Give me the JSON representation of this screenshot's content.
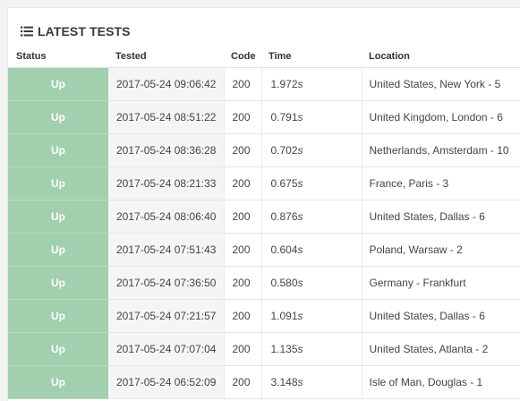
{
  "panel": {
    "title": "LATEST TESTS",
    "title_icon": "list-icon"
  },
  "table": {
    "headers": [
      "Status",
      "Tested",
      "Code",
      "Time",
      "Location"
    ],
    "rows": [
      {
        "status": "Up",
        "tested": "2017-05-24 09:06:42",
        "code": "200",
        "time": "1.972",
        "unit": "s",
        "location": "United States, New York - 5"
      },
      {
        "status": "Up",
        "tested": "2017-05-24 08:51:22",
        "code": "200",
        "time": "0.791",
        "unit": "s",
        "location": "United Kingdom, London - 6"
      },
      {
        "status": "Up",
        "tested": "2017-05-24 08:36:28",
        "code": "200",
        "time": "0.702",
        "unit": "s",
        "location": "Netherlands, Amsterdam - 10"
      },
      {
        "status": "Up",
        "tested": "2017-05-24 08:21:33",
        "code": "200",
        "time": "0.675",
        "unit": "s",
        "location": "France, Paris - 3"
      },
      {
        "status": "Up",
        "tested": "2017-05-24 08:06:40",
        "code": "200",
        "time": "0.876",
        "unit": "s",
        "location": "United States, Dallas - 6"
      },
      {
        "status": "Up",
        "tested": "2017-05-24 07:51:43",
        "code": "200",
        "time": "0.604",
        "unit": "s",
        "location": "Poland, Warsaw - 2"
      },
      {
        "status": "Up",
        "tested": "2017-05-24 07:36:50",
        "code": "200",
        "time": "0.580",
        "unit": "s",
        "location": "Germany - Frankfurt"
      },
      {
        "status": "Up",
        "tested": "2017-05-24 07:21:57",
        "code": "200",
        "time": "1.091",
        "unit": "s",
        "location": "United States, Dallas - 6"
      },
      {
        "status": "Up",
        "tested": "2017-05-24 07:07:04",
        "code": "200",
        "time": "1.135",
        "unit": "s",
        "location": "United States, Atlanta - 2"
      },
      {
        "status": "Up",
        "tested": "2017-05-24 06:52:09",
        "code": "200",
        "time": "3.148",
        "unit": "s",
        "location": "Isle of Man, Douglas - 1"
      }
    ]
  },
  "colors": {
    "status_up_bg": "#a2cfae",
    "tested_bg": "#f5f5f5",
    "page_bg": "#f3f3f4"
  }
}
